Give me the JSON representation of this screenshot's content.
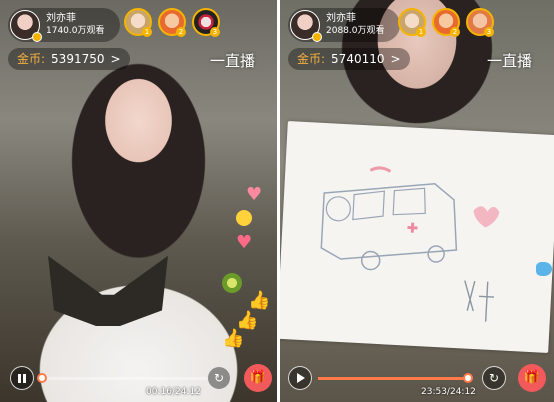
{
  "panels": [
    {
      "host": {
        "name": "刘亦菲",
        "viewers": "1740.0万观看"
      },
      "viewer_ranks": [
        "1",
        "2",
        "3"
      ],
      "coins": {
        "label": "金币:",
        "value": "5391750",
        "arrow": ">"
      },
      "live_label": "一直播",
      "playback": {
        "state": "paused",
        "time": "00:16/24:12",
        "progress": 0.011
      },
      "icons": {
        "control": "pause-icon",
        "share": "share-icon",
        "gift": "gift-icon"
      }
    },
    {
      "host": {
        "name": "刘亦菲",
        "viewers": "2088.0万观看"
      },
      "viewer_ranks": [
        "1",
        "2",
        "3"
      ],
      "coins": {
        "label": "金币:",
        "value": "5740110",
        "arrow": ">"
      },
      "live_label": "一直播",
      "playback": {
        "state": "playing",
        "time": "23:53/24:12",
        "progress": 0.987
      },
      "icons": {
        "control": "play-icon",
        "share": "share-icon",
        "gift": "gift-icon"
      }
    }
  ]
}
